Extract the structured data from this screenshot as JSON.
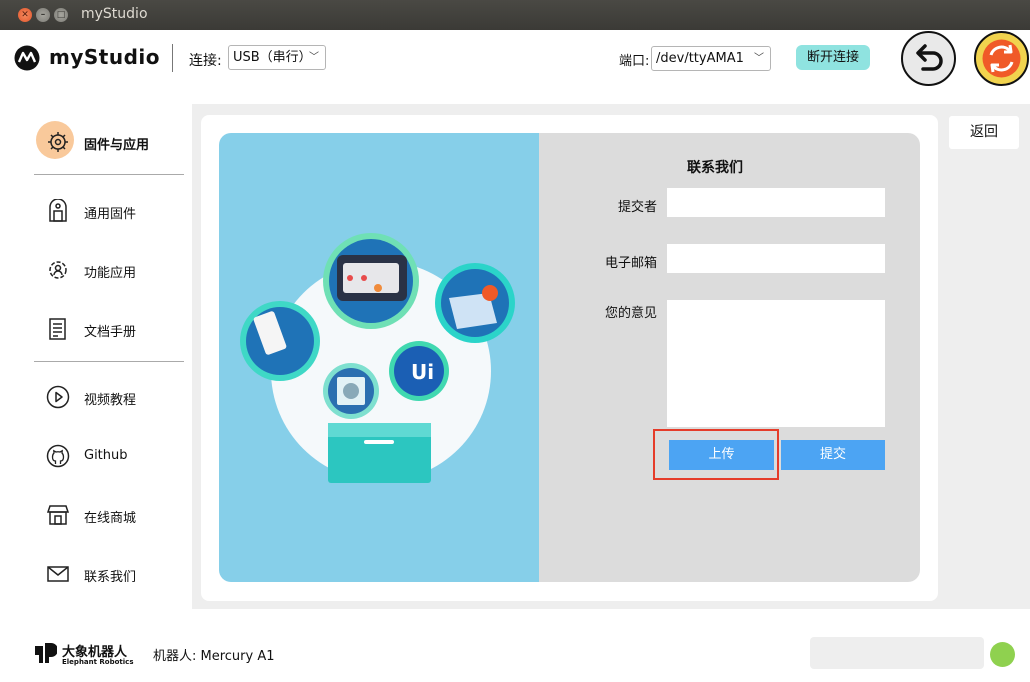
{
  "window": {
    "title": "myStudio"
  },
  "header": {
    "app_name": "myStudio",
    "connect_label": "连接:",
    "connect_value": "USB（串行）",
    "port_label": "端口:",
    "port_value": "/dev/ttyAMA1",
    "disconnect_label": "断开连接"
  },
  "sidebar": {
    "items": [
      {
        "label": "固件与应用",
        "icon": "firmware-app-icon",
        "active": true
      },
      {
        "label": "通用固件",
        "icon": "firmware-icon"
      },
      {
        "label": "功能应用",
        "icon": "gear-person-icon"
      },
      {
        "label": "文档手册",
        "icon": "document-icon"
      },
      {
        "label": "视频教程",
        "icon": "play-icon"
      },
      {
        "label": "Github",
        "icon": "github-icon"
      },
      {
        "label": "在线商城",
        "icon": "store-icon"
      },
      {
        "label": "联系我们",
        "icon": "mail-icon"
      }
    ]
  },
  "main": {
    "back_label": "返回",
    "form": {
      "title": "联系我们",
      "submitter_label": "提交者",
      "submitter_value": "",
      "email_label": "电子邮箱",
      "email_value": "",
      "opinion_label": "您的意见",
      "opinion_value": "",
      "upload_label": "上传",
      "submit_label": "提交"
    }
  },
  "footer": {
    "brand_cn": "大象机器人",
    "brand_en": "Elephant Robotics",
    "robot_label": "机器人: Mercury A1",
    "status_color": "#8fd14f"
  },
  "colors": {
    "accent_blue": "#4ca4f3",
    "highlight_red": "#e53c2a",
    "disconnect_bg": "#8fe3e0",
    "illustration_bg": "#86cfe9"
  }
}
